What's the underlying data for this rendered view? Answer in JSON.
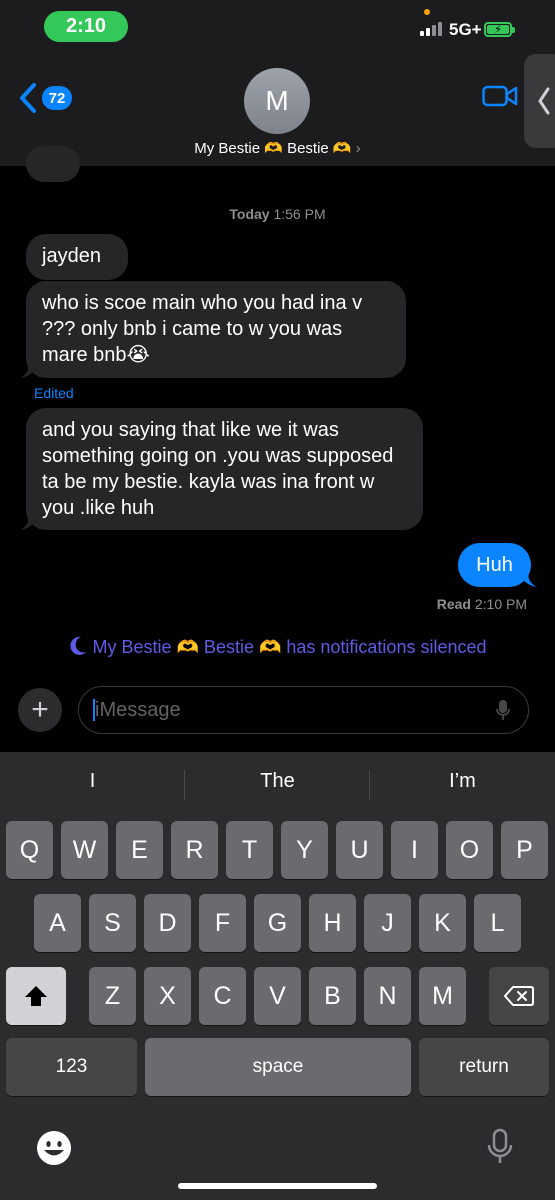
{
  "status_bar": {
    "time": "2:10",
    "network": "5G+"
  },
  "header": {
    "back_count": "72",
    "avatar_initial": "M",
    "contact_name": "My Bestie 🫶 Bestie 🫶",
    "contact_chevron": "›"
  },
  "conversation": {
    "partial_message": "…",
    "timestamp_day": "Today",
    "timestamp_time": "1:56 PM",
    "messages_in": [
      {
        "text": "jayden"
      },
      {
        "text": "who is scoe main who you had ina v ??? only bnb i came to w you was mare bnb😭"
      },
      {
        "text": "and you saying that like we it was something going on .you was supposed ta be my bestie. kayla was ina front w you .like huh"
      }
    ],
    "edited_label": "Edited",
    "message_out": "Huh",
    "read_label": "Read",
    "read_time": "2:10 PM",
    "silenced_notice": "My Bestie 🫶 Bestie 🫶 has notifications silenced"
  },
  "compose": {
    "plus_label": "+",
    "placeholder": "iMessage"
  },
  "keyboard": {
    "suggestions": [
      "I",
      "The",
      "I’m"
    ],
    "row1": [
      "Q",
      "W",
      "E",
      "R",
      "T",
      "Y",
      "U",
      "I",
      "O",
      "P"
    ],
    "row2": [
      "A",
      "S",
      "D",
      "F",
      "G",
      "H",
      "J",
      "K",
      "L"
    ],
    "row3": [
      "Z",
      "X",
      "C",
      "V",
      "B",
      "N",
      "M"
    ],
    "numbers_label": "123",
    "space_label": "space",
    "return_label": "return"
  },
  "colors": {
    "accent": "#0a84ff",
    "incoming_bubble": "#262628",
    "time_pill": "#34c759",
    "silenced_text": "#5e5ce6"
  },
  "icons": [
    "back-chevron-icon",
    "video-call-icon",
    "moon-icon",
    "microphone-icon",
    "shift-icon",
    "delete-icon",
    "emoji-icon",
    "dictation-icon"
  ]
}
